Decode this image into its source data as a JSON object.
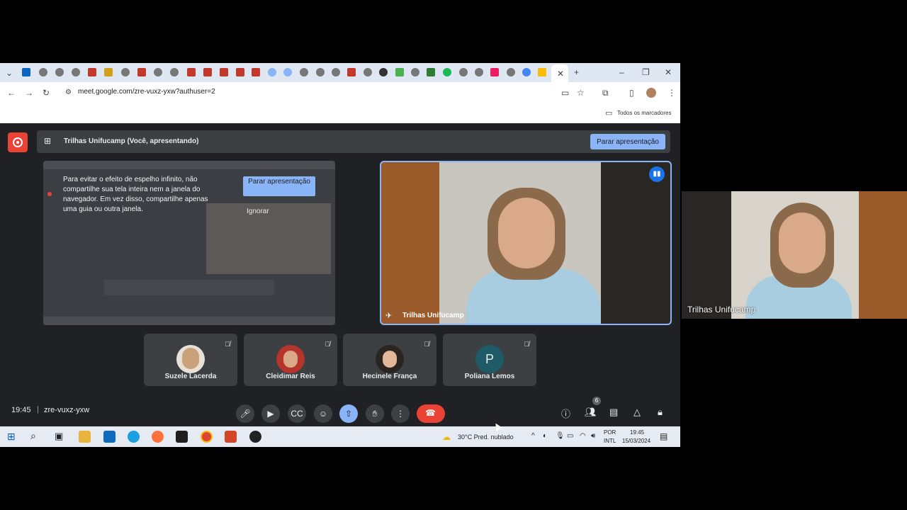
{
  "browser": {
    "url": "meet.google.com/zre-vuxz-yxw?authuser=2",
    "bookmarks_label": "Todos os marcadores"
  },
  "meet": {
    "presenting_text": "Trilhas Unifucamp (Você, apresentando)",
    "stop_presenting_label": "Parar apresentação",
    "shared_screen": {
      "warning_text": "Para evitar o efeito de espelho infinito, não compartilhe sua tela inteira nem a janela do navegador. Em vez disso, compartilhe apenas uma guia ou outra janela.",
      "stop_button_label": "Parar apresentação",
      "ignore_label": "Ignorar"
    },
    "main_tile_name": "Trilhas Unifucamp",
    "participants": [
      {
        "name": "Suzele Lacerda",
        "avatar": "photo"
      },
      {
        "name": "Cleidimar Reis",
        "avatar": "photo"
      },
      {
        "name": "Hecinele França",
        "avatar": "photo"
      },
      {
        "name": "Poliana Lemos",
        "avatar": "P"
      }
    ],
    "time": "19:45",
    "meeting_code": "zre-vuxz-yxw",
    "people_count": "6"
  },
  "taskbar": {
    "weather": "30°C  Pred. nublado",
    "lang1": "POR",
    "lang2": "INTL",
    "time": "19:45",
    "date": "15/03/2024"
  },
  "side_camera": {
    "name": "Trilhas Unifucamp"
  },
  "colors": {
    "accent": "#8ab4f8",
    "end_call": "#ea4335",
    "meet_bg": "#202124"
  }
}
